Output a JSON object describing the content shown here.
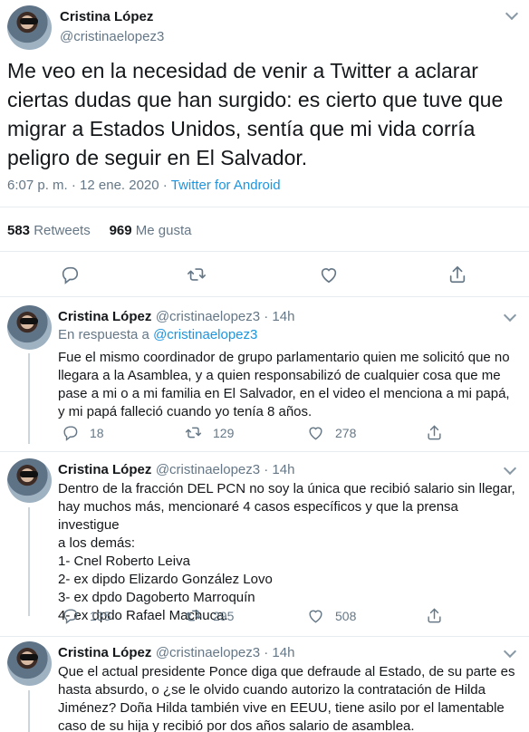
{
  "main_tweet": {
    "author_name": "Cristina López",
    "author_handle": "@cristinaelopez3",
    "text": "Me veo en la necesidad de venir a Twitter a aclarar ciertas dudas que han surgido: es cierto que tuve que migrar a Estados Unidos, sentía que mi vida corría peligro de seguir en El Salvador.",
    "time": "6:07 p. m. · 12 ene. 2020 · ",
    "source": "Twitter for Android",
    "retweets_count": "583",
    "retweets_label": " Retweets",
    "likes_count": "969",
    "likes_label": " Me gusta",
    "icons": [
      "reply-icon",
      "retweet-icon",
      "like-icon",
      "share-icon"
    ]
  },
  "replies": [
    {
      "author_name": "Cristina López",
      "author_handle": "@cristinaelopez3 · 14h",
      "reply_prefix": "En respuesta a ",
      "reply_to": "@cristinaelopez3",
      "text": "Fue el mismo coordinador de grupo parlamentario quien me solicitó que no llegara a la Asamblea, y a quien responsabilizó de cualquier cosa que me pase a mi o a mi familia en El Salvador, en el video el menciona a mi papá, y mi papá falleció cuando yo tenía 8 años.",
      "replies": "18",
      "retweets": "129",
      "likes": "278"
    },
    {
      "author_name": "Cristina López",
      "author_handle": "@cristinaelopez3 · 14h",
      "lines": [
        "Dentro de la fracción DEL PCN no soy la única que recibió salario sin llegar,",
        "hay muchos más, mencionaré 4 casos específicos y que la prensa investigue",
        "a los demás:",
        "1- Cnel Roberto Leiva",
        "2- ex dipdo Elizardo González Lovo",
        "3- ex dpdo Dagoberto Marroquín",
        "4- ex dpdo Rafael Machuca."
      ],
      "replies": "135",
      "retweets": "295",
      "likes": "508"
    },
    {
      "author_name": "Cristina López",
      "author_handle": "@cristinaelopez3 · 14h",
      "text": "Que el actual presidente Ponce diga que defraude al Estado, de su parte es hasta absurdo, o ¿se le olvido cuando autorizo la contratación de Hilda Jiménez? Doña Hilda también vive en EEUU, tiene asilo por el lamentable caso de su hija y recibió por dos años salario de asamblea."
    }
  ]
}
